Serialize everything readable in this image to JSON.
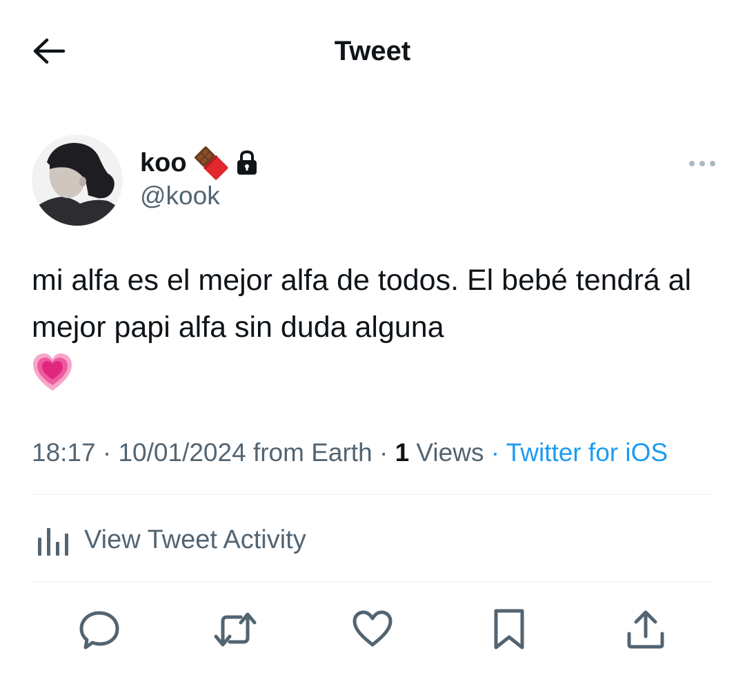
{
  "header": {
    "title": "Tweet",
    "back_icon": "arrow-left-icon"
  },
  "author": {
    "display_name": "koo",
    "name_emoji_icon": "chocolate-bar-icon",
    "protected_icon": "lock-icon",
    "handle": "@kook",
    "more_icon": "more-horizontal-icon"
  },
  "tweet": {
    "text": "mi alfa es el mejor alfa de todos. El bebé tendrá al mejor papi alfa sin duda alguna",
    "emoji_icon": "growing-heart-icon"
  },
  "meta": {
    "time": "18:17",
    "separator": " · ",
    "date": "10/01/2024",
    "location": " from Earth",
    "views_count": "1",
    "views_label": " Views",
    "source": "Twitter for iOS"
  },
  "activity": {
    "label": "View Tweet Activity",
    "icon": "bar-chart-icon"
  },
  "actions": [
    {
      "name": "reply",
      "icon": "reply-icon"
    },
    {
      "name": "retweet",
      "icon": "retweet-icon"
    },
    {
      "name": "like",
      "icon": "heart-icon"
    },
    {
      "name": "bookmark",
      "icon": "bookmark-icon"
    },
    {
      "name": "share",
      "icon": "share-icon"
    }
  ],
  "colors": {
    "text": "#0f1419",
    "secondary": "#536471",
    "accent": "#1d9bf0",
    "divider": "#eff3f4"
  }
}
